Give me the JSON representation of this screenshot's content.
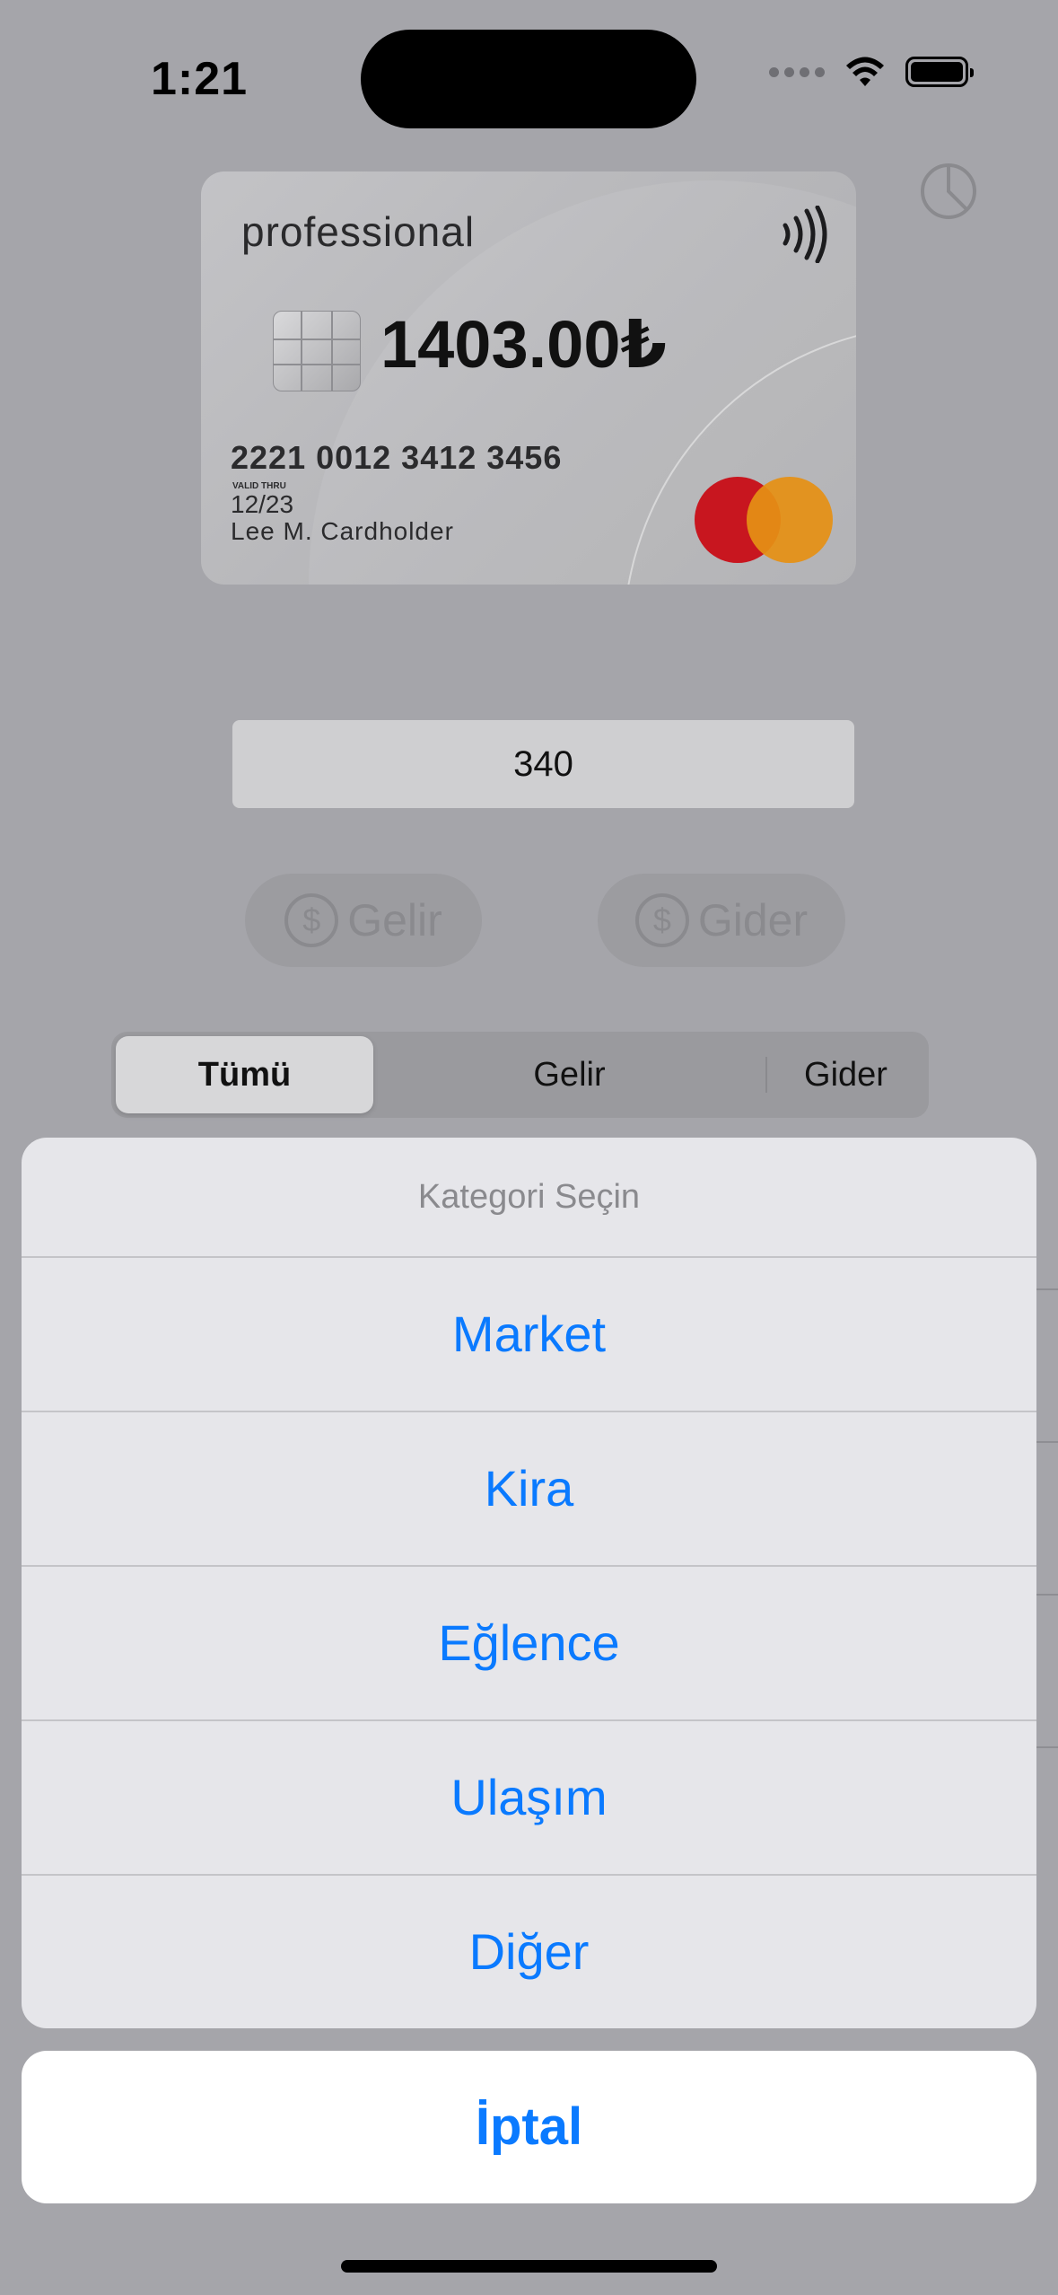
{
  "status": {
    "time": "1:21"
  },
  "card": {
    "brand": "professional",
    "balance": "1403.00₺",
    "number": "2221 0012 3412 3456",
    "valid_label": "VALID THRU",
    "expiry": "12/23",
    "holder": "Lee M. Cardholder"
  },
  "amount": {
    "value": "340"
  },
  "actions": {
    "income": "Gelir",
    "expense": "Gider",
    "currency_symbol": "$"
  },
  "filter": {
    "segments": [
      "Tümü",
      "Gelir",
      "Gider"
    ],
    "selected": "Tümü"
  },
  "action_sheet": {
    "title": "Kategori Seçin",
    "options": [
      "Market",
      "Kira",
      "Eğlence",
      "Ulaşım",
      "Diğer"
    ],
    "cancel": "İptal"
  },
  "colors": {
    "accent": "#0a7aff",
    "mastercard_red": "#c8161f",
    "mastercard_orange": "#e59014"
  }
}
